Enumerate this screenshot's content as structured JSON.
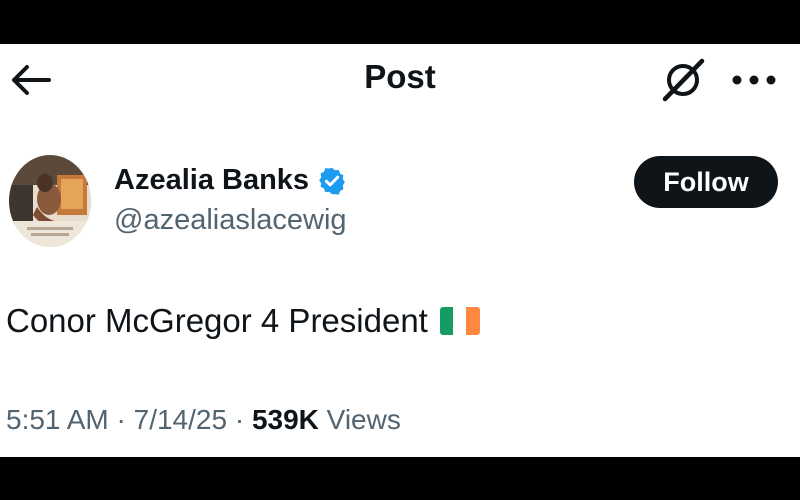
{
  "header": {
    "title": "Post"
  },
  "icons": {
    "back": "arrow-left-icon",
    "grok": "grok-icon",
    "more": "more-horizontal-icon",
    "verified": "verified-badge-icon",
    "flag": "ireland-flag-icon"
  },
  "author": {
    "name": "Azealia Banks",
    "handle": "@azealiaslacewig",
    "verified": true
  },
  "follow_button": {
    "label": "Follow"
  },
  "post": {
    "text": "Conor McGregor 4 President"
  },
  "meta": {
    "time": "5:51 AM",
    "separator": "·",
    "date": "7/14/25",
    "views_count": "539K",
    "views_label": "Views"
  },
  "colors": {
    "text_primary": "#0f1419",
    "text_secondary": "#536471",
    "verified": "#1d9bf0",
    "follow_bg": "#0f1419"
  }
}
